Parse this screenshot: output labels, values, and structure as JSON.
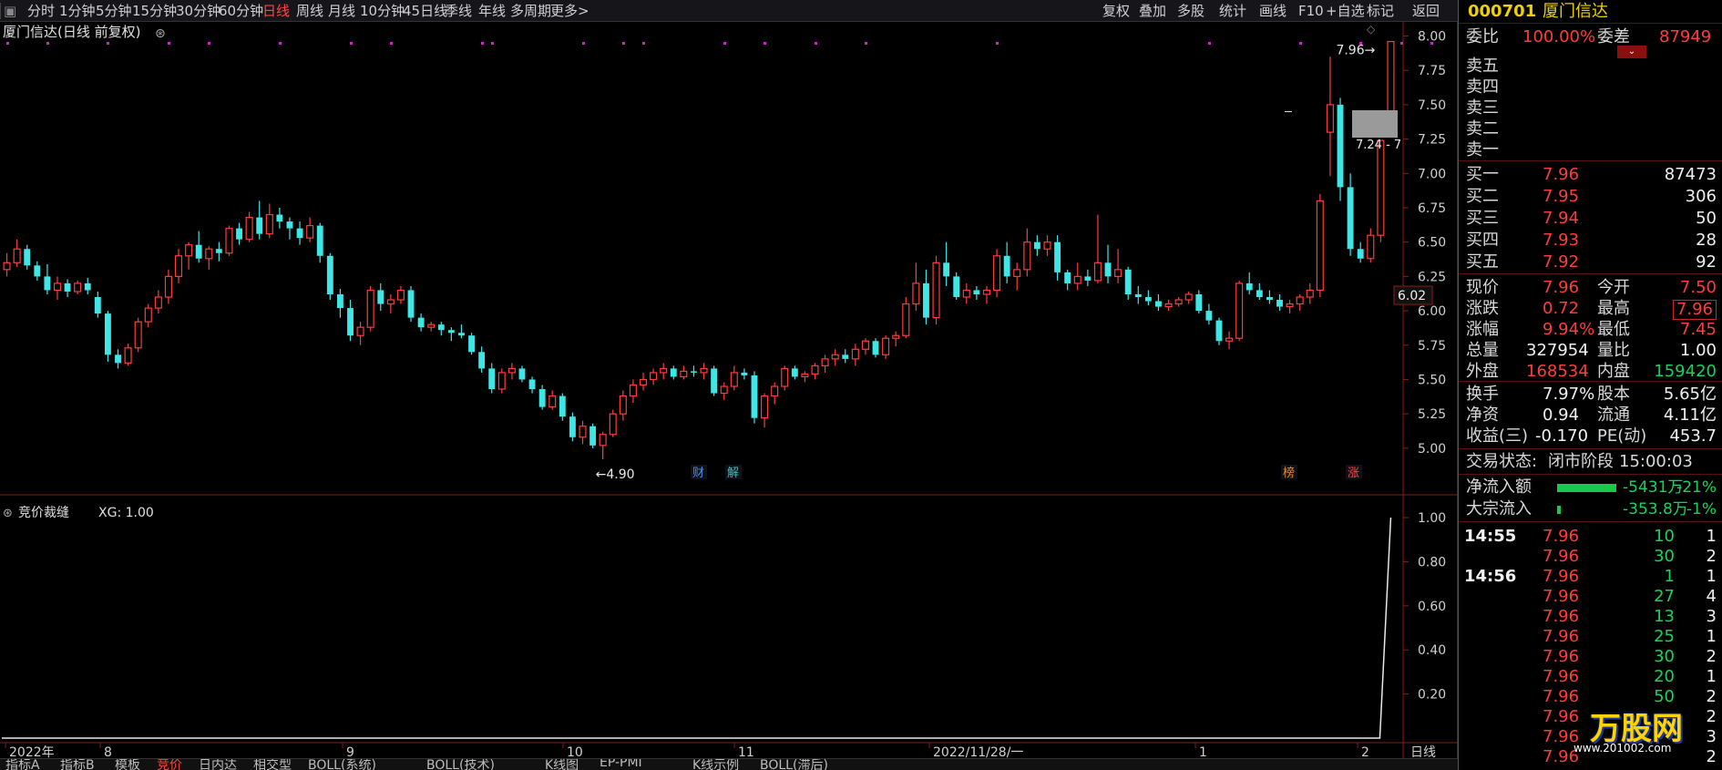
{
  "topbar": {
    "periods": [
      "分时",
      "1分钟",
      "5分钟",
      "15分钟",
      "30分钟",
      "60分钟",
      "日线",
      "周线",
      "月线",
      "10分钟",
      "45日线",
      "季线",
      "年线",
      "多周期",
      "更多>"
    ],
    "active_period": "日线",
    "tools": [
      "复权",
      "叠加",
      "多股",
      "统计",
      "画线",
      "F10",
      "+自选",
      "标记",
      "返回"
    ],
    "tools_right": [
      "返回"
    ]
  },
  "main_chart": {
    "title": "厦门信达(日线 前复权)",
    "price_ticks": [
      "8.00",
      "7.75",
      "7.50",
      "7.25",
      "7.00",
      "6.75",
      "6.50",
      "6.25",
      "6.00",
      "5.75",
      "5.50",
      "5.25",
      "5.00"
    ],
    "current_price_tag": "6.02",
    "low_label": "4.90",
    "high_label": "7.96",
    "range_label": "7.24 - 7",
    "markers": [
      {
        "text": "财",
        "color": "#4a90e2"
      },
      {
        "text": "解",
        "color": "#35c0c0"
      },
      {
        "text": "榜",
        "color": "#e08a2a"
      },
      {
        "text": "涨",
        "color": "#ff4444"
      }
    ]
  },
  "sub_chart": {
    "title": "竞价裁缝",
    "value_label": "XG: 1.00",
    "ticks": [
      "1.00",
      "0.80",
      "0.60",
      "0.40",
      "0.20"
    ]
  },
  "x_axis": {
    "labels": [
      "2022年",
      "8",
      "9",
      "10",
      "11",
      "2022/11/28/一",
      "1",
      "2"
    ],
    "period_label": "日线"
  },
  "bottom_tabs": [
    "指标A",
    "指标B",
    "模板",
    "竞价",
    "日内达",
    "相交型",
    "BOLL(系统)",
    "BOLL(技术)",
    "K线图",
    "EP-PMI",
    "K线示例",
    "BOLL(滞后)"
  ],
  "right_panel": {
    "code": "000701",
    "name": "厦门信达",
    "weibi_label": "委比",
    "weibi_value": "100.00%",
    "weicha_label": "委差",
    "weicha_value": "87949",
    "sell": [
      {
        "label": "卖五"
      },
      {
        "label": "卖四"
      },
      {
        "label": "卖三"
      },
      {
        "label": "卖二"
      },
      {
        "label": "卖一"
      }
    ],
    "buy": [
      {
        "label": "买一",
        "price": "7.96",
        "vol": "87473"
      },
      {
        "label": "买二",
        "price": "7.95",
        "vol": "306"
      },
      {
        "label": "买三",
        "price": "7.94",
        "vol": "50"
      },
      {
        "label": "买四",
        "price": "7.93",
        "vol": "28"
      },
      {
        "label": "买五",
        "price": "7.92",
        "vol": "92"
      }
    ],
    "quote": [
      {
        "l1": "现价",
        "v1": "7.96",
        "c1": "red",
        "l2": "今开",
        "v2": "7.50",
        "c2": "red"
      },
      {
        "l1": "涨跌",
        "v1": "0.72",
        "c1": "red",
        "l2": "最高",
        "v2": "7.96",
        "c2": "red"
      },
      {
        "l1": "涨幅",
        "v1": "9.94%",
        "c1": "red",
        "l2": "最低",
        "v2": "7.45",
        "c2": "red"
      },
      {
        "l1": "总量",
        "v1": "327954",
        "c1": "white",
        "l2": "量比",
        "v2": "1.00",
        "c2": "white"
      },
      {
        "l1": "外盘",
        "v1": "168534",
        "c1": "red",
        "l2": "内盘",
        "v2": "159420",
        "c2": "green"
      }
    ],
    "stats": [
      {
        "l1": "换手",
        "v1": "7.97%",
        "l2": "股本",
        "v2": "5.65亿"
      },
      {
        "l1": "净资",
        "v1": "0.94",
        "l2": "流通",
        "v2": "4.11亿"
      },
      {
        "l1": "收益(三)",
        "v1": "-0.170",
        "l2": "PE(动)",
        "v2": "453.7"
      }
    ],
    "status_label": "交易状态:",
    "status_value": "闭市阶段",
    "status_time": "15:00:03",
    "flows": [
      {
        "label": "净流入额",
        "value": "-5431万",
        "pct": "-21%",
        "bar": 0.6
      },
      {
        "label": "大宗流入",
        "value": "-353.8万",
        "pct": "-1%",
        "bar": 0.04
      }
    ],
    "ticks": [
      {
        "time": "14:55",
        "price": "7.96",
        "vol": "10",
        "n": "1"
      },
      {
        "time": "",
        "price": "7.96",
        "vol": "30",
        "n": "2"
      },
      {
        "time": "14:56",
        "price": "7.96",
        "vol": "1",
        "n": "1"
      },
      {
        "time": "",
        "price": "7.96",
        "vol": "27",
        "n": "4"
      },
      {
        "time": "",
        "price": "7.96",
        "vol": "13",
        "n": "3"
      },
      {
        "time": "",
        "price": "7.96",
        "vol": "25",
        "n": "1"
      },
      {
        "time": "",
        "price": "7.96",
        "vol": "30",
        "n": "2"
      },
      {
        "time": "",
        "price": "7.96",
        "vol": "20",
        "n": "1"
      },
      {
        "time": "",
        "price": "7.96",
        "vol": "50",
        "n": "2"
      },
      {
        "time": "",
        "price": "7.96",
        "vol": "",
        "n": "2"
      },
      {
        "time": "",
        "price": "7.96",
        "vol": "",
        "n": "3"
      },
      {
        "time": "",
        "price": "7.96",
        "vol": "",
        "n": "2"
      }
    ],
    "watermark": "万股网",
    "watermark_url": "www.201002.com"
  },
  "colors": {
    "up": "#ff3c3c",
    "down": "#3ee6e6",
    "accent": "#ff4444",
    "panel_line": "#5a1010"
  },
  "chart_data": {
    "type": "candlestick",
    "ylim": [
      4.8,
      8.05
    ],
    "candles": [
      [
        6.3,
        6.42,
        6.25,
        6.35
      ],
      [
        6.35,
        6.52,
        6.32,
        6.45
      ],
      [
        6.45,
        6.48,
        6.3,
        6.33
      ],
      [
        6.33,
        6.36,
        6.22,
        6.25
      ],
      [
        6.25,
        6.34,
        6.12,
        6.15
      ],
      [
        6.15,
        6.25,
        6.08,
        6.2
      ],
      [
        6.2,
        6.23,
        6.1,
        6.14
      ],
      [
        6.14,
        6.22,
        6.12,
        6.2
      ],
      [
        6.2,
        6.24,
        6.12,
        6.15
      ],
      [
        6.1,
        6.14,
        5.95,
        5.98
      ],
      [
        5.98,
        6.0,
        5.63,
        5.68
      ],
      [
        5.68,
        5.72,
        5.58,
        5.62
      ],
      [
        5.62,
        5.76,
        5.6,
        5.73
      ],
      [
        5.73,
        5.95,
        5.7,
        5.92
      ],
      [
        5.92,
        6.05,
        5.88,
        6.02
      ],
      [
        6.02,
        6.15,
        5.98,
        6.1
      ],
      [
        6.1,
        6.3,
        6.05,
        6.25
      ],
      [
        6.25,
        6.45,
        6.2,
        6.4
      ],
      [
        6.4,
        6.5,
        6.3,
        6.48
      ],
      [
        6.48,
        6.58,
        6.35,
        6.38
      ],
      [
        6.38,
        6.47,
        6.3,
        6.45
      ],
      [
        6.45,
        6.5,
        6.36,
        6.42
      ],
      [
        6.42,
        6.62,
        6.4,
        6.6
      ],
      [
        6.6,
        6.64,
        6.48,
        6.52
      ],
      [
        6.52,
        6.72,
        6.5,
        6.68
      ],
      [
        6.68,
        6.8,
        6.52,
        6.56
      ],
      [
        6.56,
        6.78,
        6.53,
        6.7
      ],
      [
        6.7,
        6.75,
        6.6,
        6.65
      ],
      [
        6.65,
        6.68,
        6.52,
        6.6
      ],
      [
        6.6,
        6.65,
        6.48,
        6.53
      ],
      [
        6.53,
        6.68,
        6.5,
        6.62
      ],
      [
        6.62,
        6.64,
        6.35,
        6.4
      ],
      [
        6.4,
        6.42,
        6.08,
        6.12
      ],
      [
        6.12,
        6.16,
        5.95,
        6.02
      ],
      [
        6.02,
        6.08,
        5.78,
        5.82
      ],
      [
        5.82,
        5.92,
        5.75,
        5.88
      ],
      [
        5.88,
        6.18,
        5.85,
        6.15
      ],
      [
        6.15,
        6.2,
        6.0,
        6.05
      ],
      [
        6.05,
        6.12,
        5.98,
        6.08
      ],
      [
        6.08,
        6.18,
        6.05,
        6.15
      ],
      [
        6.15,
        6.18,
        5.92,
        5.95
      ],
      [
        5.95,
        5.98,
        5.85,
        5.88
      ],
      [
        5.88,
        5.92,
        5.85,
        5.9
      ],
      [
        5.9,
        5.92,
        5.82,
        5.86
      ],
      [
        5.86,
        5.88,
        5.78,
        5.84
      ],
      [
        5.84,
        5.9,
        5.8,
        5.82
      ],
      [
        5.82,
        5.84,
        5.68,
        5.7
      ],
      [
        5.7,
        5.74,
        5.55,
        5.58
      ],
      [
        5.58,
        5.62,
        5.4,
        5.43
      ],
      [
        5.43,
        5.58,
        5.4,
        5.55
      ],
      [
        5.55,
        5.62,
        5.5,
        5.58
      ],
      [
        5.58,
        5.6,
        5.48,
        5.5
      ],
      [
        5.5,
        5.52,
        5.4,
        5.43
      ],
      [
        5.43,
        5.46,
        5.28,
        5.3
      ],
      [
        5.3,
        5.42,
        5.28,
        5.38
      ],
      [
        5.38,
        5.4,
        5.2,
        5.23
      ],
      [
        5.23,
        5.26,
        5.05,
        5.08
      ],
      [
        5.08,
        5.2,
        5.03,
        5.16
      ],
      [
        5.16,
        5.18,
        5.0,
        5.02
      ],
      [
        5.02,
        5.12,
        4.92,
        5.1
      ],
      [
        5.1,
        5.28,
        5.08,
        5.25
      ],
      [
        5.25,
        5.42,
        5.2,
        5.38
      ],
      [
        5.38,
        5.5,
        5.33,
        5.46
      ],
      [
        5.46,
        5.55,
        5.42,
        5.5
      ],
      [
        5.5,
        5.58,
        5.46,
        5.55
      ],
      [
        5.55,
        5.62,
        5.5,
        5.58
      ],
      [
        5.58,
        5.6,
        5.5,
        5.52
      ],
      [
        5.52,
        5.6,
        5.5,
        5.56
      ],
      [
        5.56,
        5.6,
        5.52,
        5.55
      ],
      [
        5.55,
        5.62,
        5.5,
        5.58
      ],
      [
        5.58,
        5.6,
        5.38,
        5.4
      ],
      [
        5.4,
        5.48,
        5.35,
        5.45
      ],
      [
        5.45,
        5.6,
        5.42,
        5.55
      ],
      [
        5.55,
        5.58,
        5.5,
        5.53
      ],
      [
        5.53,
        5.56,
        5.18,
        5.22
      ],
      [
        5.22,
        5.4,
        5.15,
        5.38
      ],
      [
        5.38,
        5.48,
        5.32,
        5.45
      ],
      [
        5.45,
        5.6,
        5.42,
        5.58
      ],
      [
        5.58,
        5.6,
        5.5,
        5.52
      ],
      [
        5.52,
        5.56,
        5.48,
        5.54
      ],
      [
        5.54,
        5.62,
        5.5,
        5.6
      ],
      [
        5.6,
        5.68,
        5.55,
        5.65
      ],
      [
        5.65,
        5.72,
        5.6,
        5.68
      ],
      [
        5.68,
        5.72,
        5.62,
        5.65
      ],
      [
        5.65,
        5.76,
        5.6,
        5.72
      ],
      [
        5.72,
        5.8,
        5.68,
        5.78
      ],
      [
        5.78,
        5.8,
        5.66,
        5.68
      ],
      [
        5.68,
        5.82,
        5.65,
        5.8
      ],
      [
        5.8,
        5.85,
        5.74,
        5.82
      ],
      [
        5.82,
        6.1,
        5.8,
        6.05
      ],
      [
        6.05,
        6.35,
        6.0,
        6.2
      ],
      [
        6.2,
        6.3,
        5.9,
        5.95
      ],
      [
        5.95,
        6.4,
        5.9,
        6.35
      ],
      [
        6.35,
        6.5,
        6.18,
        6.25
      ],
      [
        6.25,
        6.28,
        6.08,
        6.1
      ],
      [
        6.1,
        6.2,
        6.05,
        6.15
      ],
      [
        6.15,
        6.18,
        6.08,
        6.12
      ],
      [
        6.12,
        6.18,
        6.05,
        6.15
      ],
      [
        6.15,
        6.45,
        6.1,
        6.4
      ],
      [
        6.4,
        6.5,
        6.2,
        6.25
      ],
      [
        6.25,
        6.35,
        6.15,
        6.3
      ],
      [
        6.3,
        6.6,
        6.25,
        6.5
      ],
      [
        6.5,
        6.55,
        6.4,
        6.45
      ],
      [
        6.45,
        6.55,
        6.4,
        6.5
      ],
      [
        6.5,
        6.55,
        6.22,
        6.28
      ],
      [
        6.28,
        6.3,
        6.15,
        6.2
      ],
      [
        6.2,
        6.35,
        6.15,
        6.25
      ],
      [
        6.25,
        6.3,
        6.18,
        6.22
      ],
      [
        6.22,
        6.7,
        6.2,
        6.35
      ],
      [
        6.35,
        6.48,
        6.2,
        6.25
      ],
      [
        6.25,
        6.45,
        6.2,
        6.3
      ],
      [
        6.3,
        6.32,
        6.08,
        6.12
      ],
      [
        6.12,
        6.18,
        6.05,
        6.1
      ],
      [
        6.1,
        6.15,
        6.04,
        6.07
      ],
      [
        6.07,
        6.12,
        6.0,
        6.03
      ],
      [
        6.03,
        6.08,
        6.0,
        6.05
      ],
      [
        6.05,
        6.1,
        6.03,
        6.08
      ],
      [
        6.08,
        6.14,
        6.05,
        6.12
      ],
      [
        6.12,
        6.15,
        5.98,
        6.0
      ],
      [
        6.0,
        6.05,
        5.9,
        5.93
      ],
      [
        5.93,
        5.95,
        5.75,
        5.78
      ],
      [
        5.78,
        5.85,
        5.72,
        5.8
      ],
      [
        5.8,
        6.22,
        5.78,
        6.2
      ],
      [
        6.2,
        6.28,
        6.12,
        6.15
      ],
      [
        6.15,
        6.2,
        6.08,
        6.1
      ],
      [
        6.1,
        6.15,
        6.05,
        6.08
      ],
      [
        6.08,
        6.12,
        6.0,
        6.03
      ],
      [
        6.03,
        6.08,
        5.98,
        6.05
      ],
      [
        6.05,
        6.12,
        6.0,
        6.1
      ],
      [
        6.1,
        6.2,
        6.05,
        6.15
      ],
      [
        6.15,
        6.85,
        6.1,
        6.8
      ],
      [
        7.3,
        7.85,
        6.98,
        7.5
      ],
      [
        7.5,
        7.55,
        6.8,
        6.9
      ],
      [
        6.9,
        7.0,
        6.4,
        6.45
      ],
      [
        6.45,
        6.5,
        6.35,
        6.38
      ],
      [
        6.38,
        6.6,
        6.35,
        6.55
      ],
      [
        6.55,
        7.24,
        6.5,
        7.24
      ],
      [
        7.45,
        7.96,
        7.45,
        7.96
      ]
    ],
    "xg": {
      "values_count": 150,
      "last_value": 1.0
    },
    "markers_price": [
      4.9,
      7.96
    ]
  }
}
